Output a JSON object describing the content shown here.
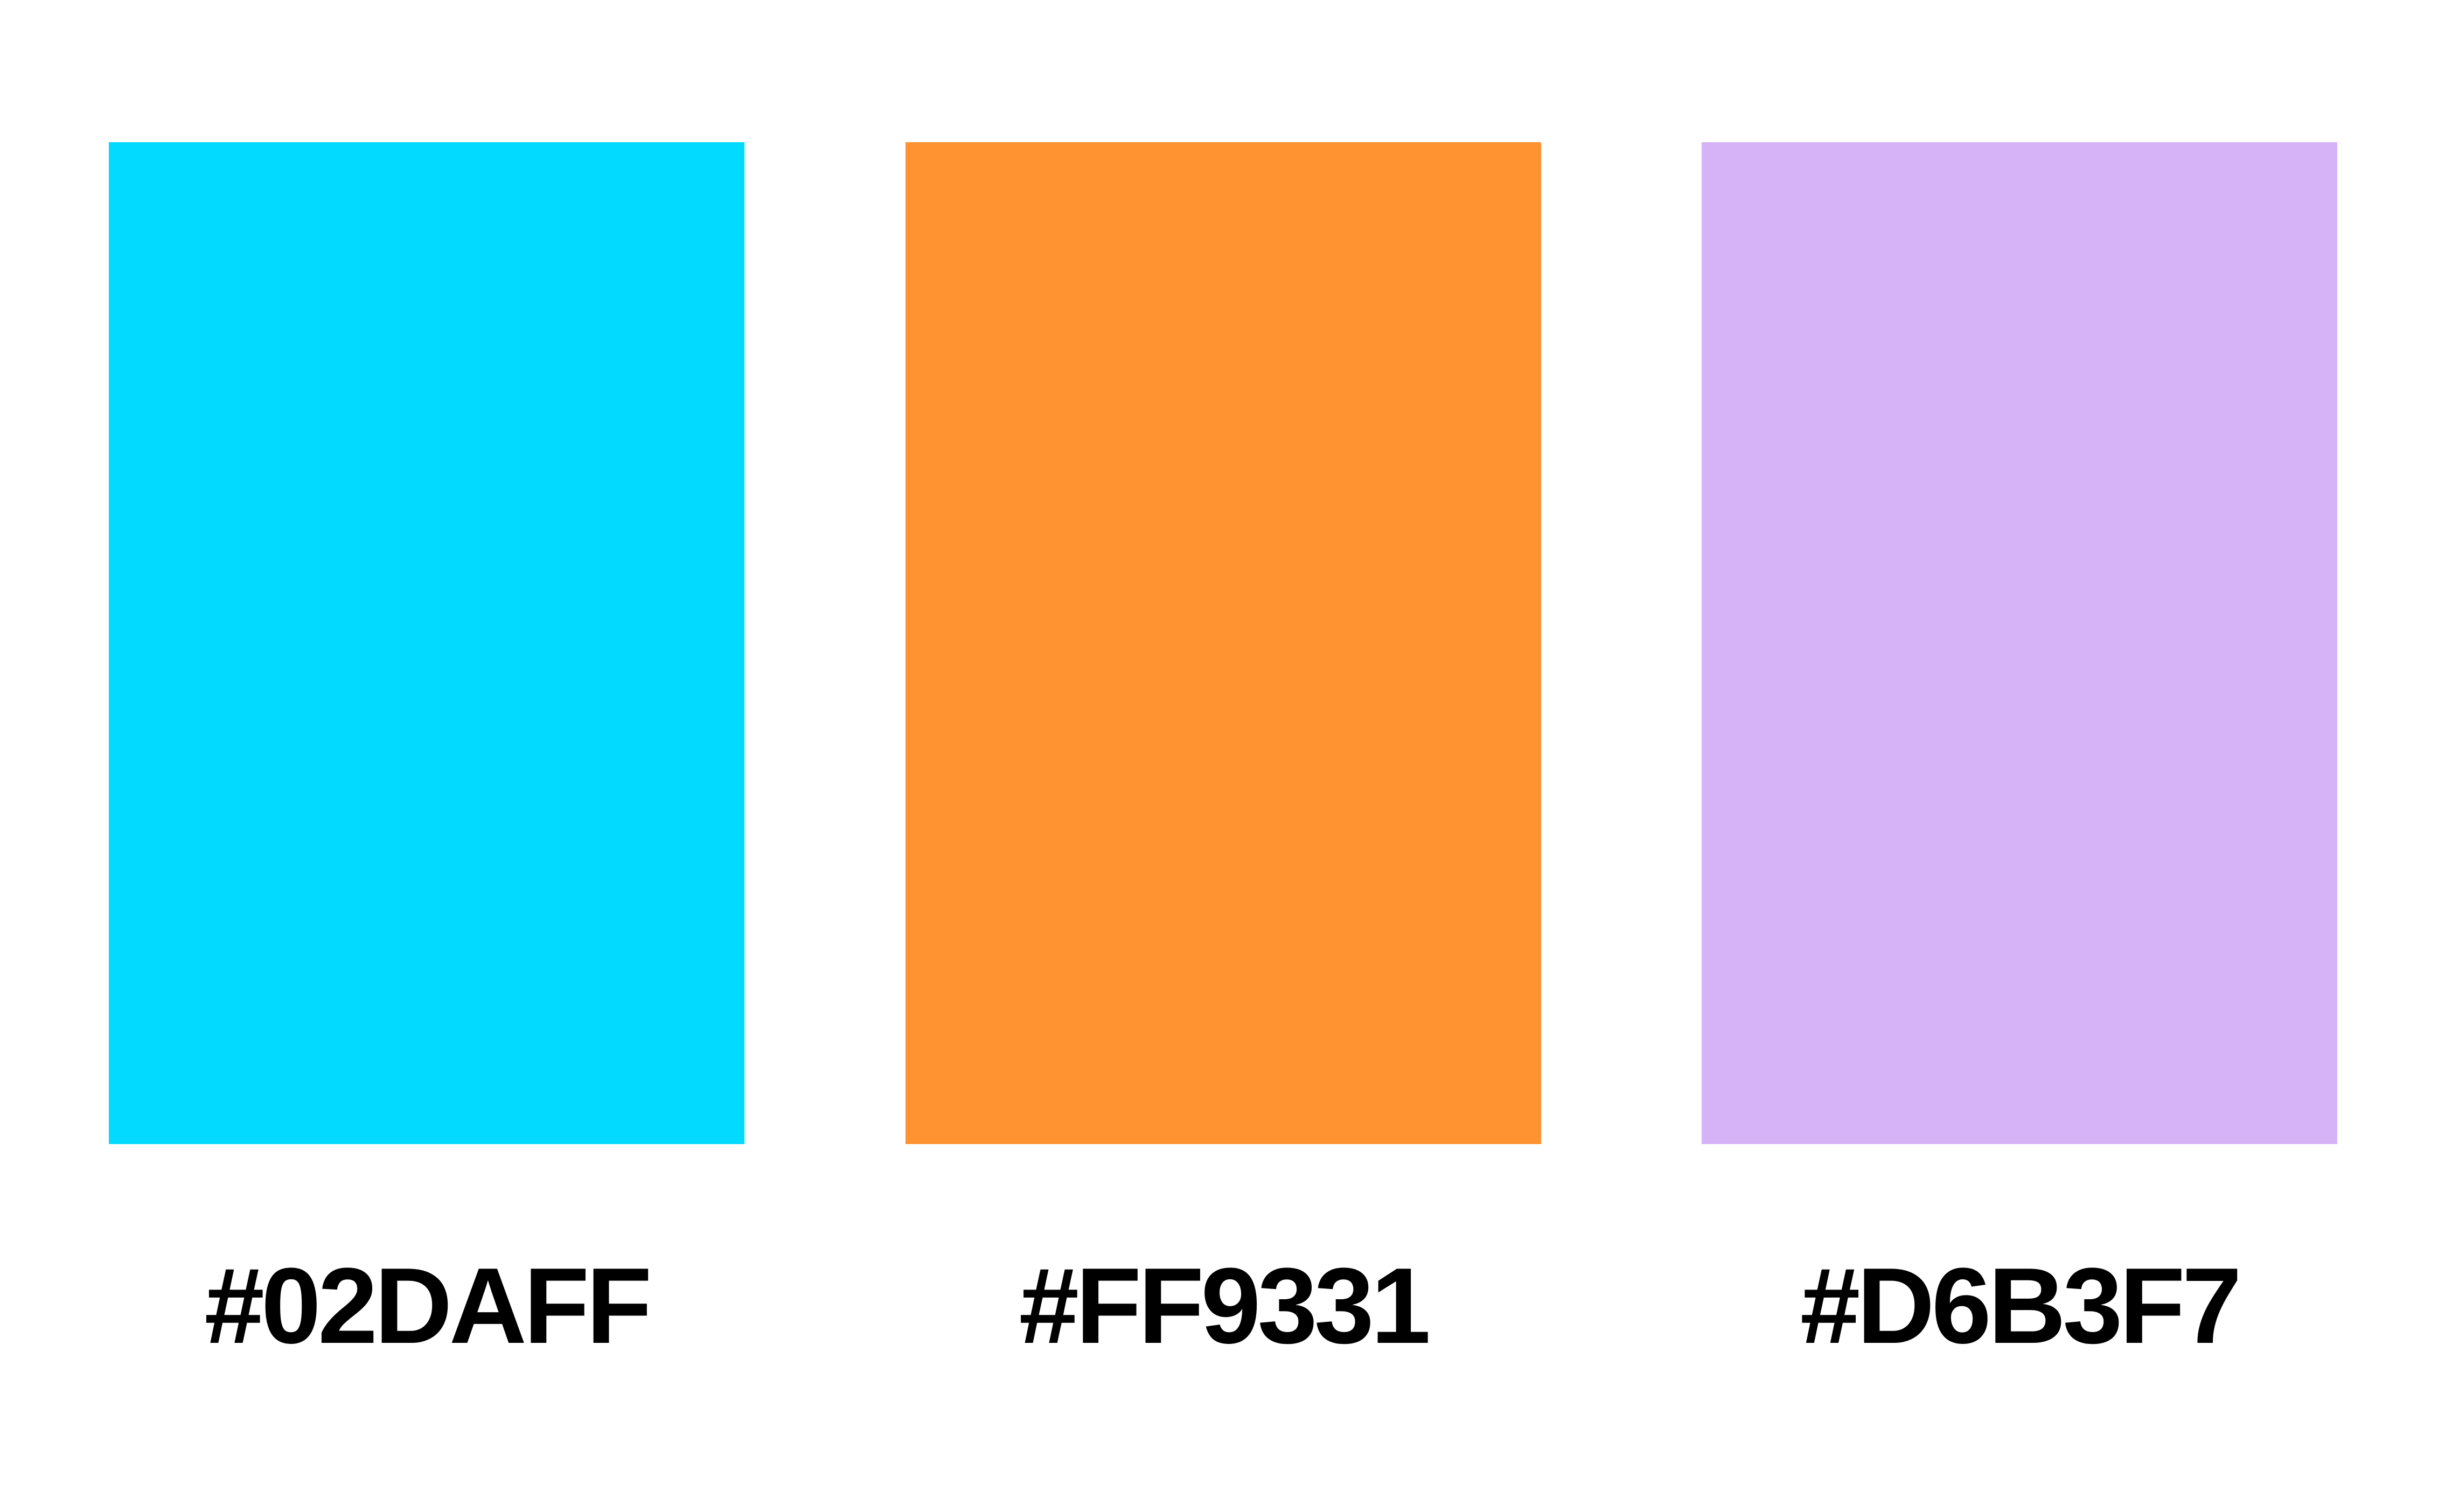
{
  "swatches": [
    {
      "label": "#02DAFF",
      "color": "#02DAFF"
    },
    {
      "label": "#FF9331",
      "color": "#FF9331"
    },
    {
      "label": "#D6B3F7",
      "color": "#D6B3F7"
    }
  ]
}
